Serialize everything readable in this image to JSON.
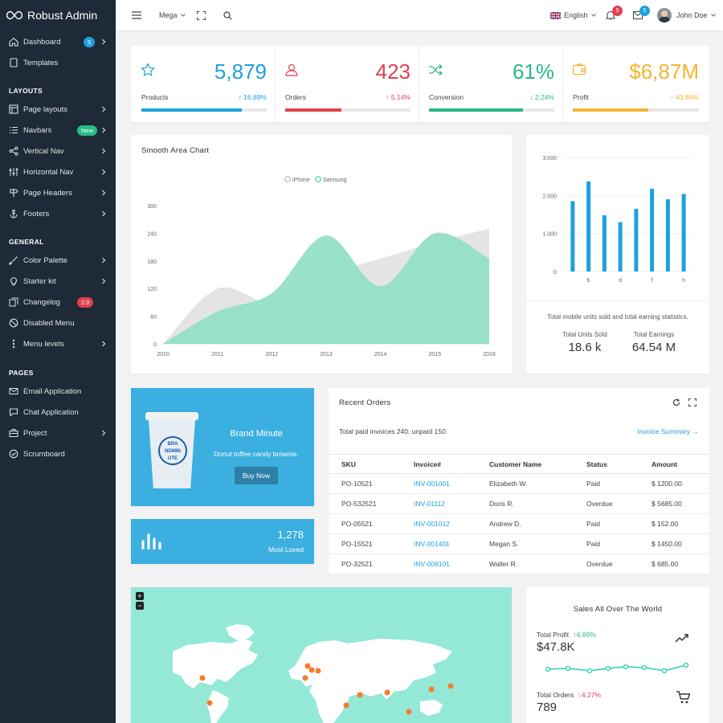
{
  "brand": {
    "name": "Robust Admin"
  },
  "sidebar": {
    "top": [
      {
        "label": "Dashboard",
        "icon": "home-icon",
        "badge": "5",
        "badge_color": "#1da1dc"
      },
      {
        "label": "Templates",
        "icon": "tablet-icon"
      }
    ],
    "sections": [
      {
        "title": "LAYOUTS",
        "items": [
          {
            "label": "Page layouts",
            "icon": "layout-icon"
          },
          {
            "label": "Navbars",
            "icon": "list-icon",
            "badge": "New",
            "badge_color": "#28b987"
          },
          {
            "label": "Vertical Nav",
            "icon": "share-icon"
          },
          {
            "label": "Horizontal Nav",
            "icon": "sliders-icon"
          },
          {
            "label": "Page Headers",
            "icon": "sign-icon"
          },
          {
            "label": "Footers",
            "icon": "anchor-icon"
          }
        ]
      },
      {
        "title": "GENERAL",
        "items": [
          {
            "label": "Color Palette",
            "icon": "brush-icon"
          },
          {
            "label": "Starter kit",
            "icon": "bulb-icon"
          },
          {
            "label": "Changelog",
            "icon": "copy-icon",
            "badge": "2.0",
            "badge_color": "#e0404f"
          },
          {
            "label": "Disabled Menu",
            "icon": "ban-icon"
          },
          {
            "label": "Menu levels",
            "icon": "dots-vertical-icon"
          }
        ]
      },
      {
        "title": "PAGES",
        "items": [
          {
            "label": "Email Application",
            "icon": "envelope-icon"
          },
          {
            "label": "Chat Application",
            "icon": "chat-icon"
          },
          {
            "label": "Project",
            "icon": "briefcase-icon"
          },
          {
            "label": "Scrumboard",
            "icon": "check-circle-icon"
          }
        ]
      }
    ]
  },
  "header": {
    "mega": "Mega",
    "language": "English",
    "notif_count": "5",
    "mail_count": "5",
    "user_name": "John Doe"
  },
  "stats": [
    {
      "value": "5,879",
      "label": "Products",
      "pct": "16.89%",
      "trend": "up",
      "color": "#1da1dc",
      "progress": 0.8,
      "icon": "star-icon"
    },
    {
      "value": "423",
      "label": "Orders",
      "pct": "5.14%",
      "trend": "up",
      "color": "#e0404f",
      "progress": 0.45,
      "icon": "user-icon"
    },
    {
      "value": "61%",
      "label": "Conversion",
      "pct": "2.24%",
      "trend": "down",
      "color": "#28b987",
      "progress": 0.75,
      "icon": "shuffle-icon"
    },
    {
      "value": "$6,87M",
      "label": "Profit",
      "pct": "43.84%",
      "trend": "up",
      "color": "#f3b52f",
      "progress": 0.6,
      "icon": "wallet-icon"
    }
  ],
  "area_chart": {
    "title": "Smooth Area Chart",
    "chart_data": {
      "type": "area",
      "x": [
        "2010",
        "2011",
        "2012",
        "2013",
        "2014",
        "2015",
        "2016"
      ],
      "series": [
        {
          "name": "iPhone",
          "values": [
            0,
            120,
            90,
            150,
            185,
            220,
            250
          ],
          "color": "#e4e4e4"
        },
        {
          "name": "Samsung",
          "values": [
            0,
            70,
            110,
            235,
            125,
            240,
            185
          ],
          "color": "#93dfc6"
        }
      ],
      "yticks": [
        "0",
        "60",
        "120",
        "180",
        "240",
        "300"
      ],
      "ylim": [
        0,
        300
      ]
    }
  },
  "bar_chart": {
    "chart_data": {
      "type": "bar",
      "categories": [
        "",
        "b",
        "",
        "d",
        "",
        "f",
        "",
        "h"
      ],
      "values": [
        1850,
        2370,
        1480,
        1300,
        1650,
        2180,
        1900,
        2040
      ],
      "yticks": [
        "0",
        "1.000",
        "2.000",
        "3.000"
      ],
      "ylim": [
        0,
        3000
      ],
      "color": "#1da1dc"
    },
    "caption": "Total mobile units sold and total earning statistics.",
    "stats": [
      {
        "label": "Total Units Sold",
        "value": "18.6 k"
      },
      {
        "label": "Total Earnings",
        "value": "64.54 M"
      }
    ]
  },
  "promo": {
    "title": "Brand Minute",
    "text": "Donut toffee candy brownie.",
    "button": "Buy Now",
    "cup_text": [
      "BRA",
      "NDMIN",
      "UTE"
    ]
  },
  "loved": {
    "value": "1,278",
    "label": "Most Loved"
  },
  "orders": {
    "title": "Recent Orders",
    "summary": "Total paid invoices 240, unpaid 150.",
    "link": "Invoice Summary",
    "columns": [
      "SKU",
      "Invoice#",
      "Customer Name",
      "Status",
      "Amount"
    ],
    "rows": [
      [
        "PO-10521",
        "INV-001001",
        "Elizabeth W.",
        "Paid",
        "$ 1200.00"
      ],
      [
        "PO-532521",
        "INV-01112",
        "Doris R.",
        "Overdue",
        "$ 5685.00"
      ],
      [
        "PO-05521",
        "INV-001012",
        "Andrew D.",
        "Paid",
        "$ 152.00"
      ],
      [
        "PO-15521",
        "INV-001401",
        "Megan S.",
        "Paid",
        "$ 1450.00"
      ],
      [
        "PO-32521",
        "INV-008101",
        "Walter R.",
        "Overdue",
        "$ 685.00"
      ]
    ]
  },
  "map": {
    "zoom_in": "+",
    "zoom_out": "−"
  },
  "world": {
    "title": "Sales All Over The World",
    "profit_label": "Total Profit",
    "profit_pct": "6.89%",
    "profit_value": "$47.8K",
    "orders_label": "Total Orders",
    "orders_pct": "4.27%",
    "orders_value": "789"
  }
}
